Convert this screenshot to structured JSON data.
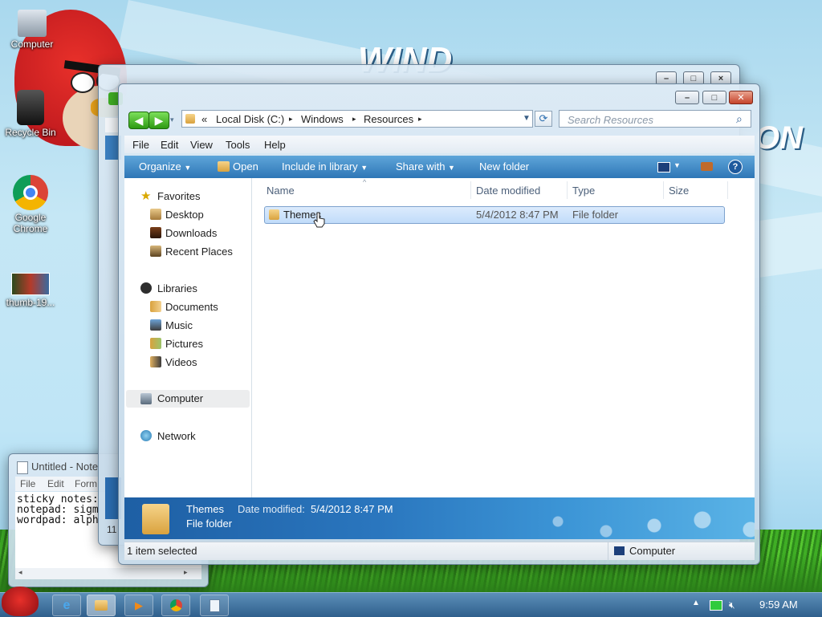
{
  "desktop": {
    "icons": [
      {
        "label": "Computer"
      },
      {
        "label": "Recycle Bin"
      },
      {
        "label": "Google Chrome"
      },
      {
        "label": "thumb-19..."
      }
    ]
  },
  "notepad": {
    "title": "Untitled - Note",
    "menu": [
      "File",
      "Edit",
      "Form"
    ],
    "lines": [
      "sticky notes:",
      "notepad: sigm",
      "wordpad: alph"
    ]
  },
  "back_window": {
    "status": "11"
  },
  "explorer": {
    "breadcrumb": [
      "Local Disk (C:)",
      "Windows",
      "Resources"
    ],
    "breadcrumb_prefix": "«",
    "search_placeholder": "Search Resources",
    "menu": [
      "File",
      "Edit",
      "View",
      "Tools",
      "Help"
    ],
    "commands": {
      "organize": "Organize",
      "open": "Open",
      "include_in_library": "Include in library",
      "share_with": "Share with",
      "new_folder": "New folder"
    },
    "nav": {
      "favorites": "Favorites",
      "desktop": "Desktop",
      "downloads": "Downloads",
      "recent_places": "Recent Places",
      "libraries": "Libraries",
      "documents": "Documents",
      "music": "Music",
      "pictures": "Pictures",
      "videos": "Videos",
      "computer": "Computer",
      "network": "Network"
    },
    "columns": {
      "name": "Name",
      "date_modified": "Date modified",
      "type": "Type",
      "size": "Size"
    },
    "files": [
      {
        "name": "Themes",
        "date_modified": "5/4/2012 8:47 PM",
        "type": "File folder",
        "size": ""
      }
    ],
    "details": {
      "name": "Themes",
      "date_label": "Date modified:",
      "date_value": "5/4/2012 8:47 PM",
      "type": "File folder"
    },
    "status": {
      "selection": "1 item selected",
      "location": "Computer"
    }
  },
  "taskbar": {
    "clock": "9:59 AM"
  },
  "colors": {
    "accent": "#2e76b6",
    "selection": "#c1dcfa",
    "nav_green": "#2e9a13"
  }
}
